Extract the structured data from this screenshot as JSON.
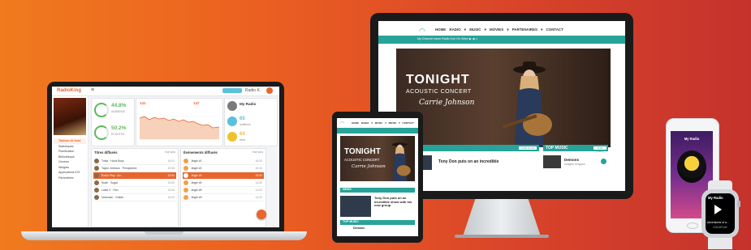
{
  "colors": {
    "brand_orange": "#e8652c",
    "teal": "#27a39a",
    "success": "#5cb85c"
  },
  "laptop": {
    "app_logo": "RadioKing",
    "menu_icon": "hamburger-icon",
    "user_name": "Radio K.",
    "nav_items": [
      "Tableau de bord",
      "Statistiques",
      "Planification",
      "Bibliothèque",
      "Générer",
      "Widgets",
      "Applications iOS",
      "Paramètres"
    ],
    "stats": {
      "first_pct": "44.8%",
      "first_label": "AUDIENCE",
      "second_pct": "50.2%",
      "second_label": "ÉCOUTES"
    },
    "chart": {
      "left_value": "141",
      "right_value": "147"
    },
    "right_panel": {
      "title": "My Radio",
      "listeners_value": "65",
      "listeners_label": "auditeurs",
      "small_value": "64",
      "small_label": "titres"
    },
    "list_left": {
      "title": "Titres diffusés",
      "action": "Voir tous",
      "rows": [
        {
          "text": "Tulsa · Hood Boys",
          "time": "16:01"
        },
        {
          "text": "Taylor Johnson · Perspective",
          "time": "15:58"
        },
        {
          "text": "Radio Play · Arr...",
          "time": "15:54"
        },
        {
          "text": "Noah · Sugar",
          "time": "15:50"
        },
        {
          "text": "Label X · Flux",
          "time": "15:46"
        },
        {
          "text": "Unknown · Guilde",
          "time": "15:42"
        }
      ],
      "highlight_index": 2
    },
    "list_right": {
      "title": "Évènements diffusés",
      "action": "Voir tous",
      "rows": [
        {
          "text": "Jingle #1",
          "time": "16:00"
        },
        {
          "text": "Jingle #2",
          "time": "15:30"
        },
        {
          "text": "Jingle #3",
          "time": "15:00"
        },
        {
          "text": "Jingle #4",
          "time": "14:30"
        },
        {
          "text": "Jingle #5",
          "time": "14:00"
        },
        {
          "text": "Jingle #6",
          "time": "13:30"
        }
      ],
      "highlight_index": 2
    }
  },
  "monitor": {
    "logo_icon": "radio-waves-icon",
    "menu": [
      "HOME",
      "RADIO ▾",
      "MUSIC ▾",
      "MOVIES ▾",
      "PARTENAIRES ▾",
      "CONTACT"
    ],
    "player_text": "My Channel name   Radio Live On Wave   ▶  ◀  ♫",
    "hero": {
      "title": "TONIGHT",
      "subtitle": "ACOUSTIC CONCERT",
      "artist": "Carrie Johnson"
    },
    "news_button": "VOIR PLUS",
    "news_headline": "Tony Don puts on an incredible",
    "top_music_title": "TOP MUSIC",
    "top_music_button": "VOIR TOUT",
    "top_item": {
      "title": "Demons",
      "artist": "Imagine Dragons"
    }
  },
  "tablet": {
    "menu": [
      "HOME",
      "RADIO ▾",
      "MUSIC ▾",
      "MOVIE ▾",
      "CONTACT"
    ],
    "hero": {
      "title": "TONIGHT",
      "subtitle": "ACOUSTIC CONCERT",
      "artist": "Carrie Johnson"
    },
    "news_label": "NEWS",
    "news_headline": "Tony Don puts on an incredible show with his new group",
    "top_label": "TOP MUSIC",
    "top_item": "Demons"
  },
  "phone": {
    "title": "My Radio"
  },
  "watch": {
    "title": "My Radio",
    "song": "Adventures of a...",
    "artist": "COLDPLAY"
  }
}
